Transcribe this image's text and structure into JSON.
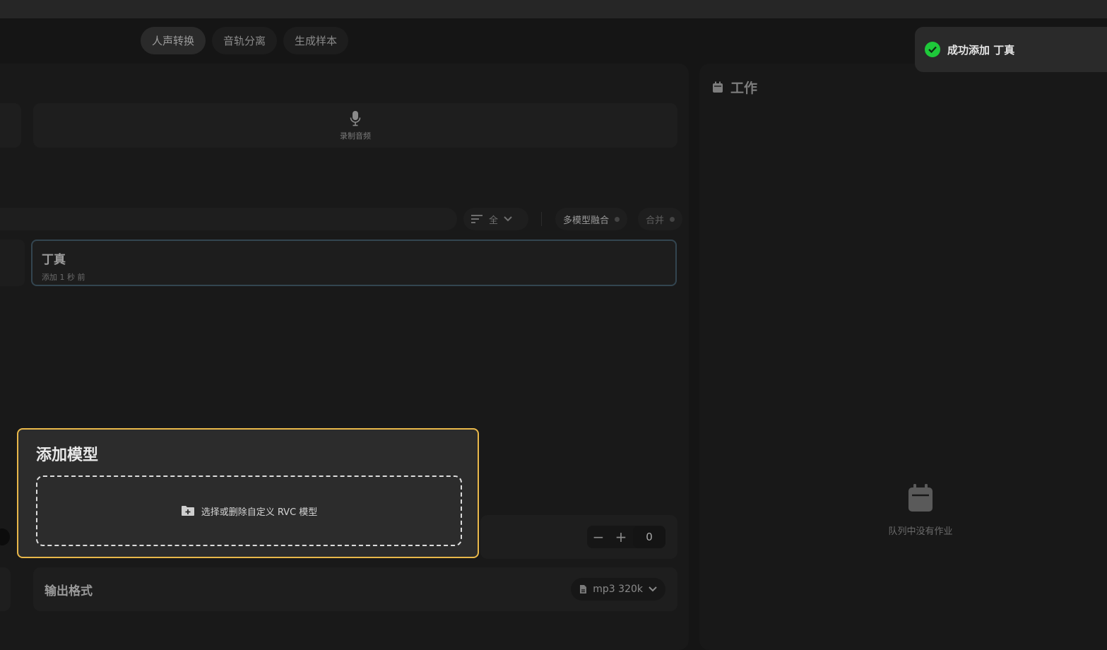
{
  "tabs": [
    {
      "label": "人声转换",
      "active": true
    },
    {
      "label": "音轨分离",
      "active": false
    },
    {
      "label": "生成样本",
      "active": false
    }
  ],
  "record": {
    "label": "录制音频",
    "icon": "microphone-icon"
  },
  "sort": {
    "label": "全",
    "icon": "sort-icon"
  },
  "toggles": {
    "multi_model": "多模型融合",
    "merge": "合并"
  },
  "model": {
    "name": "丁真",
    "added": "添加 1 秒 前"
  },
  "stepper": {
    "minus": "−",
    "plus": "+",
    "value": "0"
  },
  "output": {
    "label": "输出格式",
    "format": "mp3 320k"
  },
  "jobs": {
    "title": "工作",
    "empty": "队列中没有作业"
  },
  "toast": {
    "message": "成功添加 丁真",
    "status_color": "#1ec93a"
  },
  "dialog": {
    "title": "添加模型",
    "dropzone_label": "选择或删除自定义 RVC 模型",
    "border_color": "#e9b84a"
  }
}
